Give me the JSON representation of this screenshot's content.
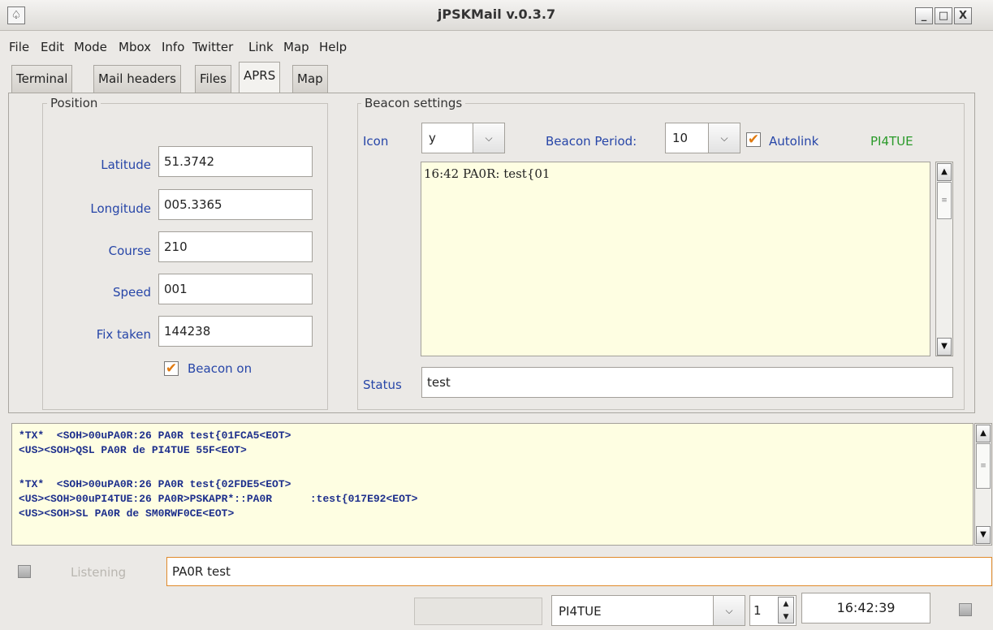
{
  "window": {
    "title": "jPSKMail v.0.3.7",
    "app_icon_glyph": "♤",
    "minimize_glyph": "_",
    "maximize_glyph": "□",
    "close_glyph": "X"
  },
  "menu": [
    "File",
    "Edit",
    "Mode",
    "Mbox",
    "Info",
    "Twitter",
    "Link",
    "Map",
    "Help"
  ],
  "tabs": [
    "Terminal",
    "Mail headers",
    "Files",
    "APRS",
    "Map"
  ],
  "active_tab": "APRS",
  "position": {
    "title": "Position",
    "latitude_label": "Latitude",
    "latitude": "51.3742",
    "longitude_label": "Longitude",
    "longitude": "005.3365",
    "course_label": "Course",
    "course": "210",
    "speed_label": "Speed",
    "speed": "001",
    "fix_label": "Fix taken",
    "fix": "144238",
    "beacon_on_label": "Beacon on",
    "beacon_on_checked": true
  },
  "beacon": {
    "title": "Beacon settings",
    "icon_label": "Icon",
    "icon_value": "y",
    "period_label": "Beacon Period:",
    "period_value": "10",
    "autolink_label": "Autolink",
    "autolink_checked": true,
    "callsign": "PI4TUE",
    "messages": "16:42 PA0R: test{01",
    "status_label": "Status",
    "status_value": "test"
  },
  "log_lines": [
    "*TX*  <SOH>00uPA0R:26 PA0R test{01FCA5<EOT>",
    "<US><SOH>QSL PA0R de PI4TUE 55F<EOT>",
    "",
    "*TX*  <SOH>00uPA0R:26 PA0R test{02FDE5<EOT>",
    "<US><SOH>00uPI4TUE:26 PA0R>PSKAPR*::PA0R      :test{017E92<EOT>",
    "<US><SOH>SL PA0R de SM0RWF0CE<EOT>"
  ],
  "bottom": {
    "listening_label": "Listening",
    "command_value": "PA0R test",
    "server_value": "PI4TUE",
    "spinner_value": "1",
    "clock": "16:42:39"
  },
  "colors": {
    "accent_checkbox": "#e07a10",
    "label_blue": "#2746a8",
    "callsign_green": "#2a9a2a",
    "log_bg": "#fefee2"
  }
}
